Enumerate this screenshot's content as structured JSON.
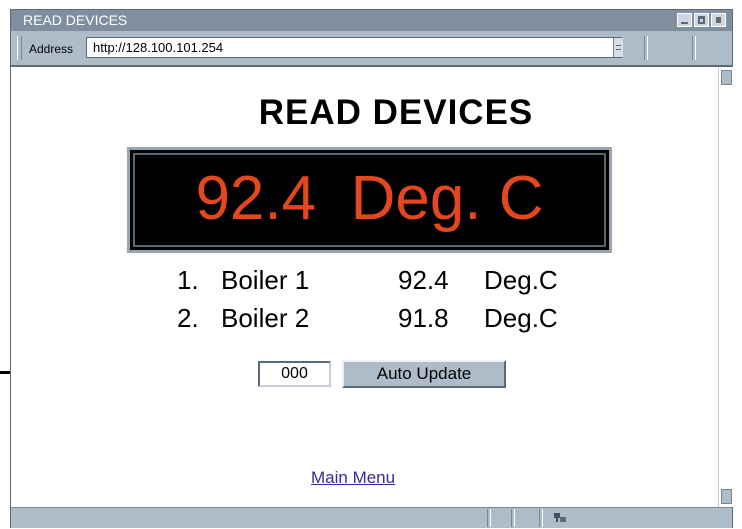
{
  "window": {
    "title": "READ DEVICES"
  },
  "addressbar": {
    "label": "Address",
    "url": "http://128.100.101.254"
  },
  "page": {
    "heading": "READ DEVICES",
    "display_value": "92.4  Deg. C",
    "readings": [
      {
        "num": "1.",
        "name": "Boiler 1",
        "value": "92.4",
        "unit": "Deg.C"
      },
      {
        "num": "2.",
        "name": "Boiler 2",
        "value": "91.8",
        "unit": "Deg.C"
      }
    ],
    "counter_value": "000",
    "auto_update_label": "Auto Update",
    "main_menu_label": "Main Menu"
  },
  "icons": {
    "status_icon": "network-icon",
    "window_buttons": [
      "minimize-icon",
      "maximize-icon",
      "close-icon"
    ]
  },
  "colors": {
    "display_text": "#e4471d",
    "chrome": "#aebcca",
    "titlebar": "#7f8fa0"
  }
}
